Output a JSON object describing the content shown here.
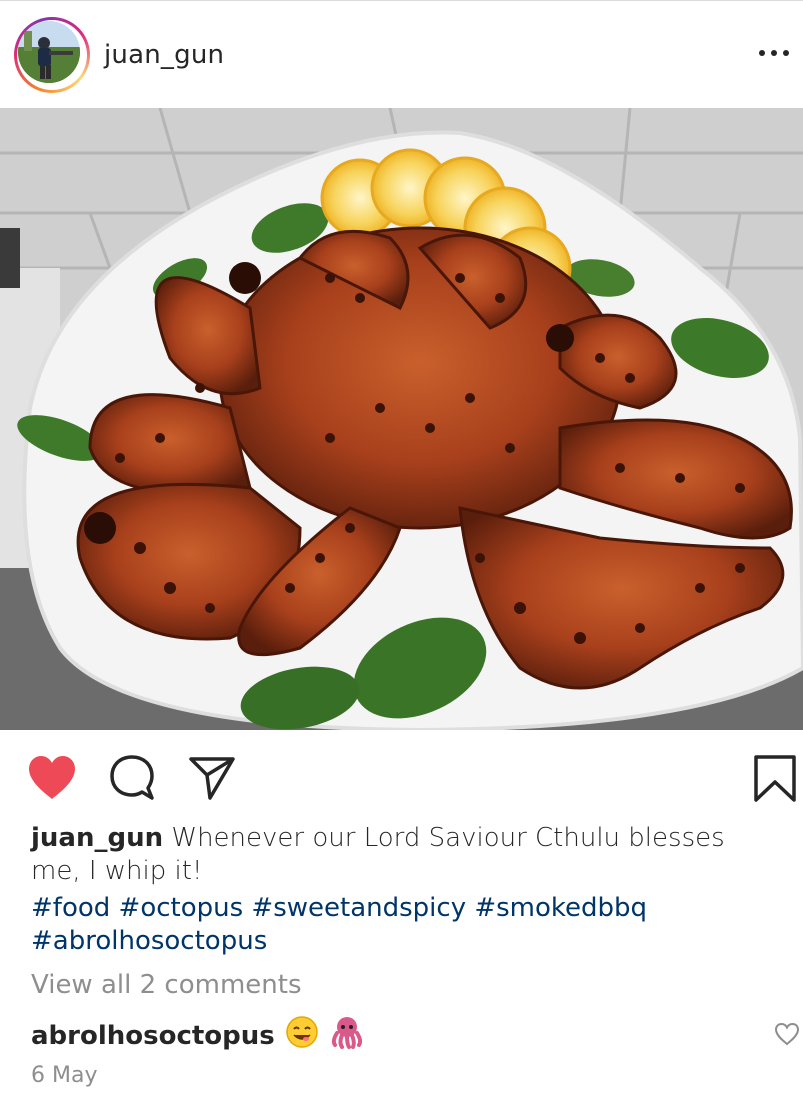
{
  "post": {
    "username": "juan_gun",
    "caption_user": "juan_gun",
    "caption_text": "Whenever our Lord Saviour Cthulu blesses me, I whip it!",
    "hashtags": [
      "#food",
      "#octopus",
      "#sweetandspicy",
      "#smokedbbq",
      "#abrolhosoctopus"
    ],
    "view_comments": "View all 2 comments",
    "comment": {
      "user": "abrolhosoctopus"
    },
    "date": "6 May"
  },
  "icons": {
    "more": "more-dots-icon",
    "like": "heart-filled-icon",
    "comment": "comment-bubble-icon",
    "share": "paper-plane-icon",
    "save": "bookmark-icon",
    "comment_like": "heart-outline-icon"
  },
  "colors": {
    "like_red": "#ed4956",
    "hashtag_blue": "#003569",
    "muted_gray": "#8e8e8e"
  }
}
